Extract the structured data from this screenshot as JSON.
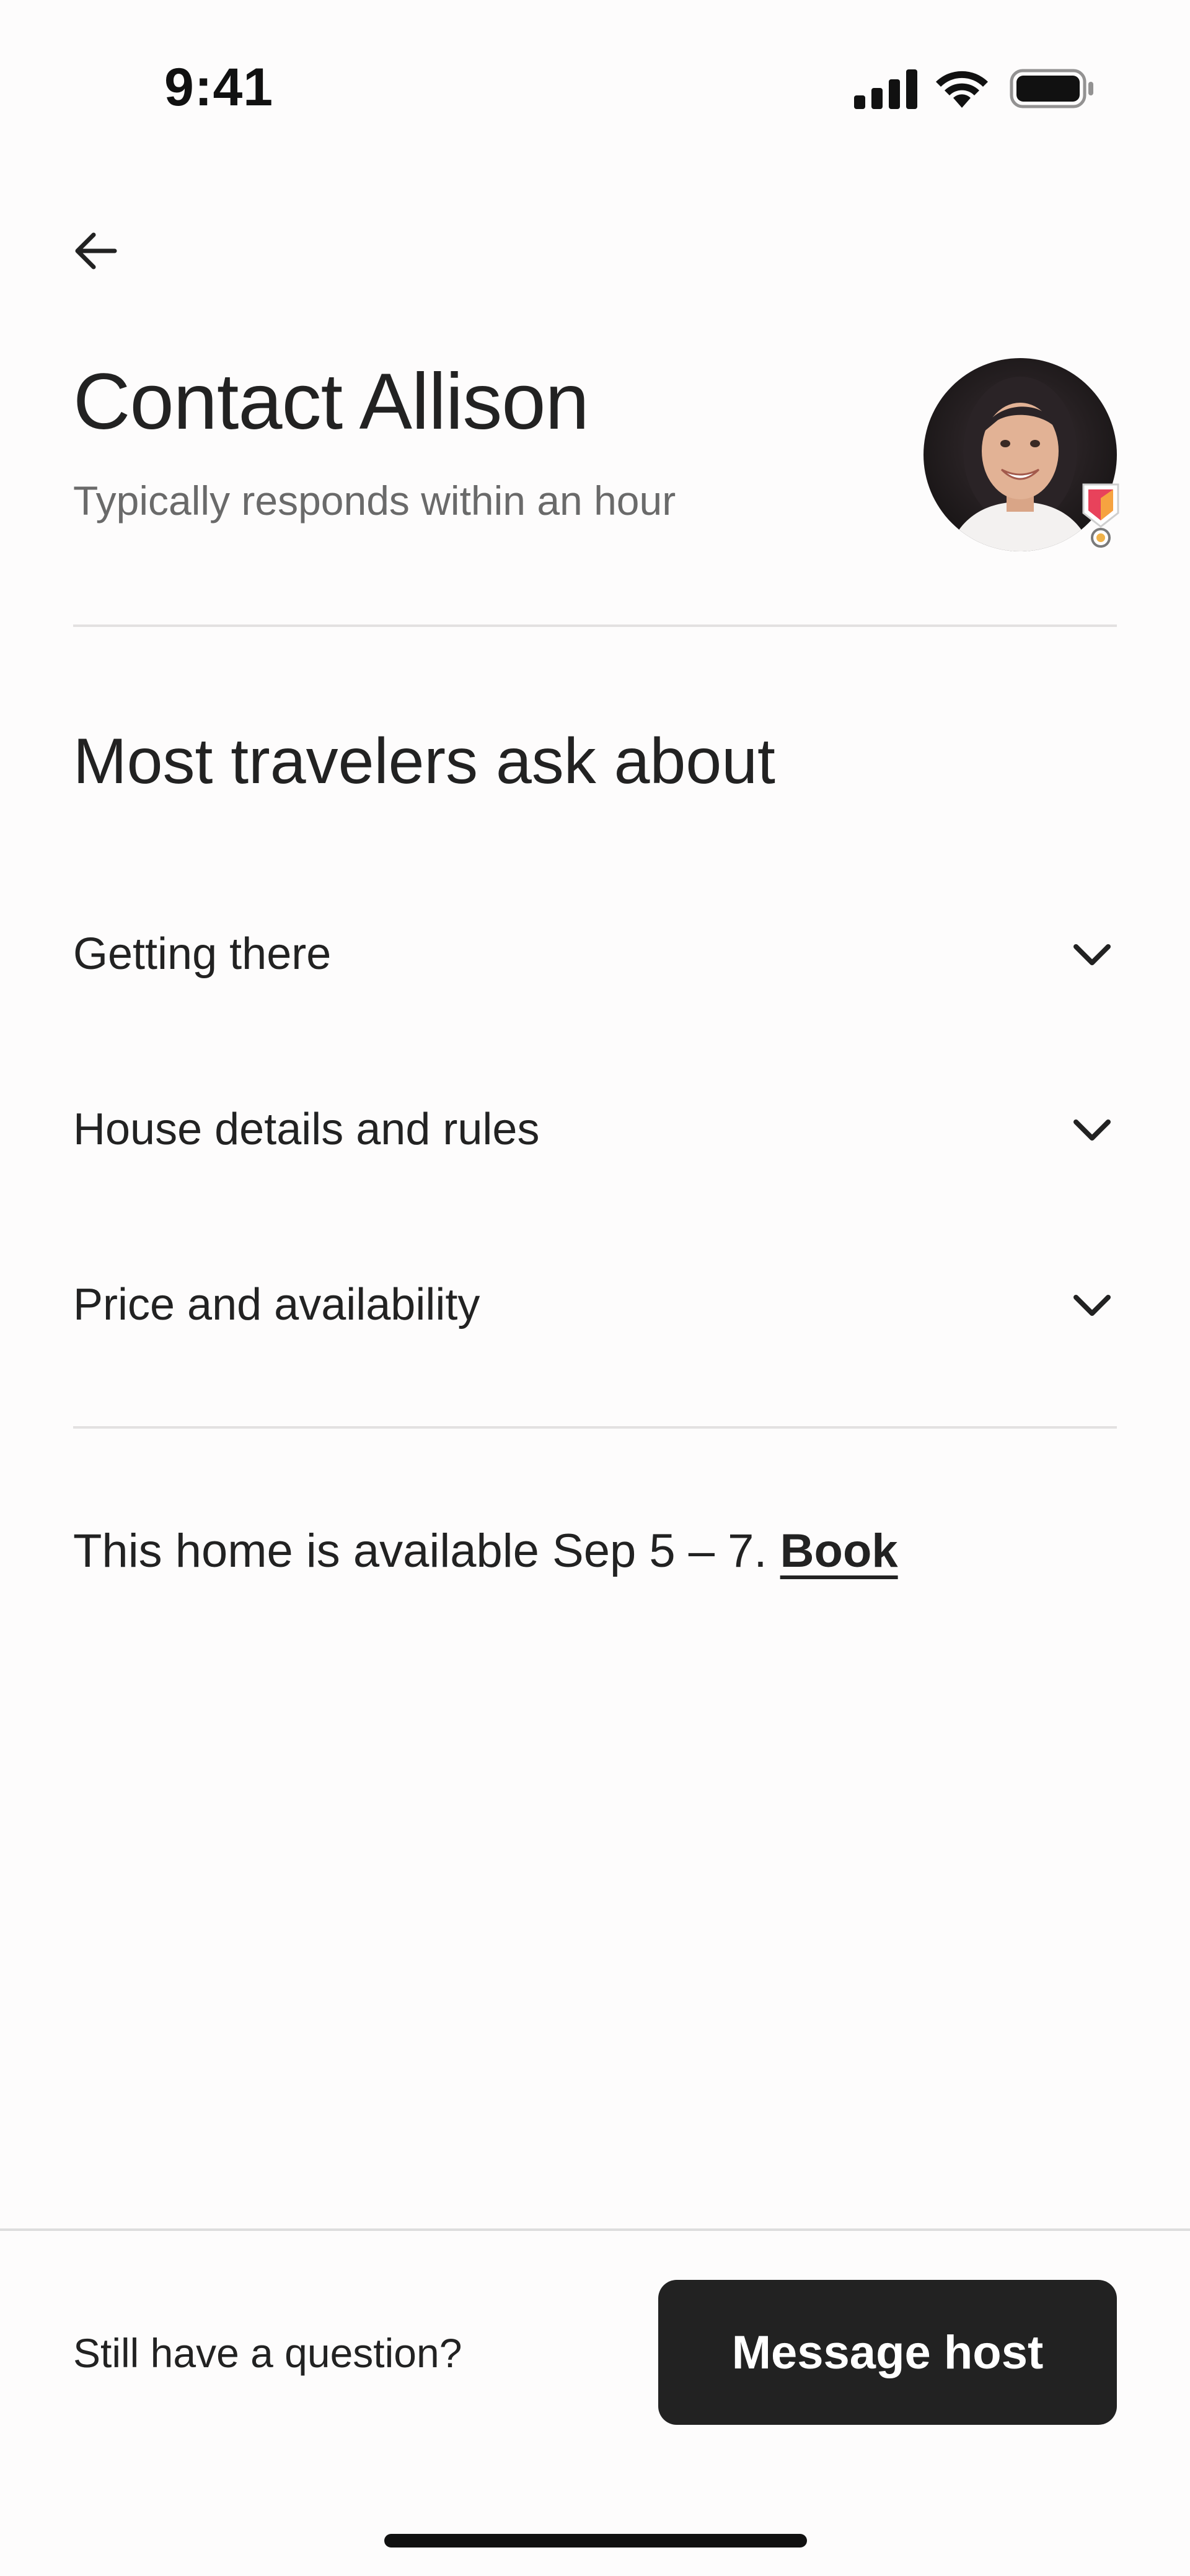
{
  "status_bar": {
    "time": "9:41",
    "icons": [
      "cellular-signal-icon",
      "wifi-icon",
      "battery-icon"
    ]
  },
  "nav": {
    "back_icon": "arrow-left-icon"
  },
  "header": {
    "title": "Contact Allison",
    "subtitle": "Typically responds within an hour",
    "avatar_badge_icon": "superhost-badge-icon"
  },
  "faq": {
    "title": "Most travelers ask about",
    "items": [
      {
        "label": "Getting there",
        "icon": "chevron-down-icon"
      },
      {
        "label": "House details and rules",
        "icon": "chevron-down-icon"
      },
      {
        "label": "Price and availability",
        "icon": "chevron-down-icon"
      }
    ]
  },
  "availability": {
    "text": "This home is available Sep 5 – 7.",
    "link_label": "Book"
  },
  "footer": {
    "question": "Still have a question?",
    "button_label": "Message host"
  },
  "colors": {
    "background": "#fdfcfc",
    "text": "#222222",
    "muted": "#6a6a6a",
    "button": "#222222",
    "badge_accent": "#e8425b"
  }
}
